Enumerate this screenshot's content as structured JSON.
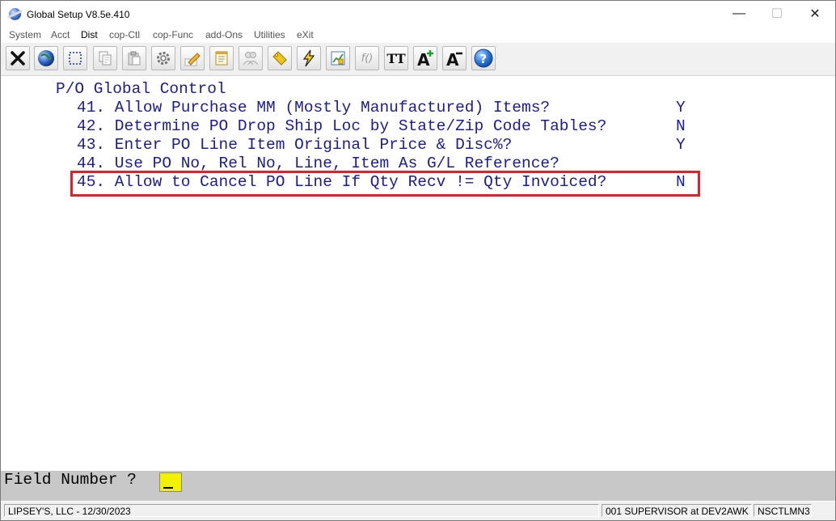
{
  "window": {
    "title": "Global Setup V8.5e.410",
    "minimize_symbol": "—",
    "maximize_symbol": "☐",
    "close_symbol": "✕"
  },
  "menu": {
    "items": [
      {
        "label": "System"
      },
      {
        "label": "Acct"
      },
      {
        "label": "Dist"
      },
      {
        "label": "cop-Ctl"
      },
      {
        "label": "cop-Func"
      },
      {
        "label": "add-Ons"
      },
      {
        "label": "Utilities"
      },
      {
        "label": "eXit"
      }
    ]
  },
  "toolbar": {
    "buttons": [
      {
        "icon": "close-x-icon"
      },
      {
        "icon": "globe-icon"
      },
      {
        "icon": "select-rect-icon"
      },
      {
        "icon": "copy-icon"
      },
      {
        "icon": "paste-icon"
      },
      {
        "icon": "settings-gear-icon"
      },
      {
        "icon": "edit-pencil-icon"
      },
      {
        "icon": "notepad-icon"
      },
      {
        "icon": "users-icon"
      },
      {
        "icon": "key-tag-icon"
      },
      {
        "icon": "lightning-icon"
      },
      {
        "icon": "chart-icon"
      },
      {
        "icon": "function-icon"
      },
      {
        "icon": "text-format-icon"
      },
      {
        "icon": "font-increase-icon"
      },
      {
        "icon": "font-decrease-icon"
      },
      {
        "icon": "help-icon"
      }
    ],
    "font_tt": "TT",
    "font_a": "A",
    "help_glyph": "?",
    "fx_glyph": "f()"
  },
  "screen": {
    "heading": "P/O Global Control",
    "fields": [
      {
        "label": "41. Allow Purchase MM (Mostly Manufactured) Items?",
        "value": "Y"
      },
      {
        "label": "42. Determine PO Drop Ship Loc by State/Zip Code Tables?",
        "value": "N"
      },
      {
        "label": "43. Enter PO Line Item Original Price & Disc%?",
        "value": "Y"
      },
      {
        "label": "44. Use PO No, Rel No, Line, Item As G/L Reference?",
        "value": ""
      },
      {
        "label": "45. Allow to Cancel PO Line If Qty Recv != Qty Invoiced?",
        "value": "N"
      }
    ]
  },
  "prompt": {
    "label": "Field Number ?"
  },
  "status": {
    "company": "LIPSEY'S, LLC - 12/30/2023",
    "user": "001 SUPERVISOR at DEV2AWK",
    "program": "NSCTLMN3"
  },
  "colors": {
    "highlight_border": "#e0202b",
    "terminal_text": "#1c1c8e",
    "input_bg": "#f2f200"
  }
}
